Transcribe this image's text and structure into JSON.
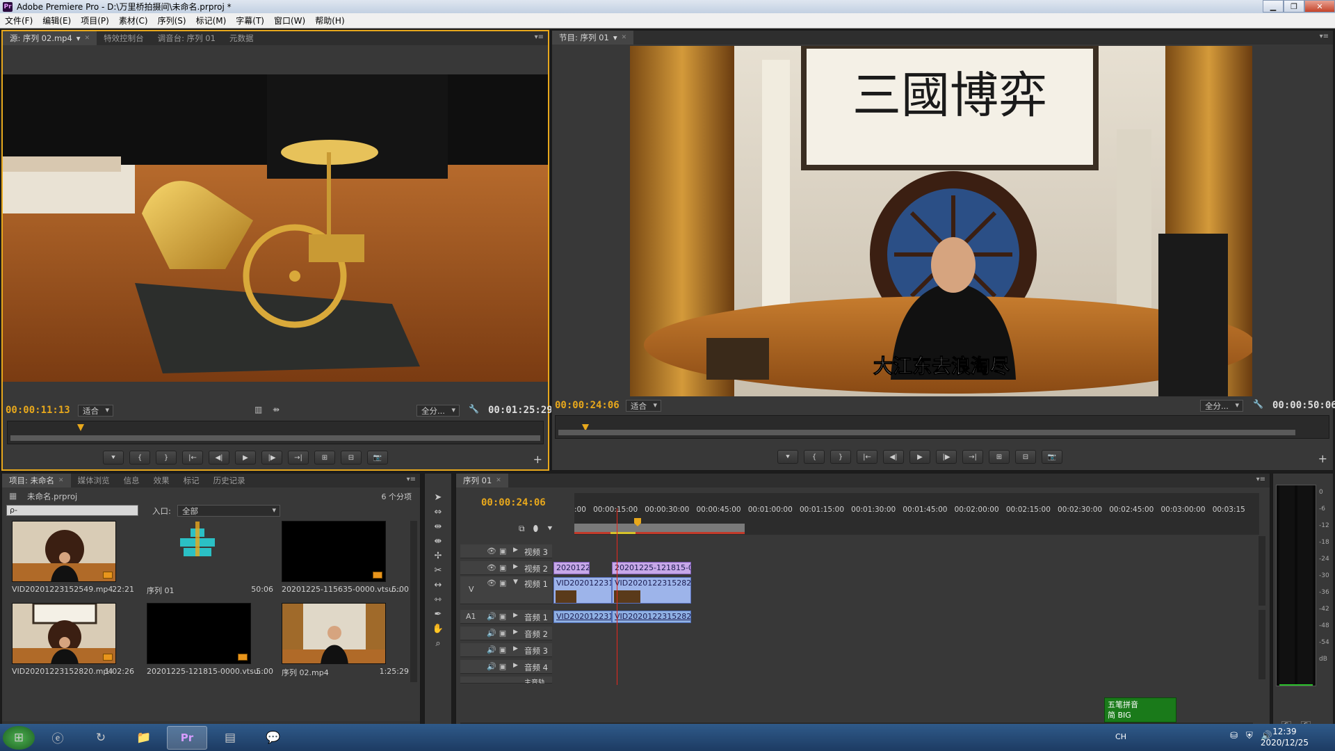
{
  "window": {
    "title": "Adobe Premiere Pro - D:\\万里桥拍摄间\\未命名.prproj *",
    "app_icon": "Pr"
  },
  "menu": [
    "文件(F)",
    "编辑(E)",
    "项目(P)",
    "素材(C)",
    "序列(S)",
    "标记(M)",
    "字幕(T)",
    "窗口(W)",
    "帮助(H)"
  ],
  "source": {
    "tabs": [
      "源: 序列 02.mp4",
      "特效控制台",
      "调音台: 序列 01",
      "元数据"
    ],
    "timecode": "00:00:11:13",
    "fit": "适合",
    "quality": "全分...",
    "duration": "00:01:25:29"
  },
  "program": {
    "tab": "节目: 序列 01",
    "subtitle": "大江东去浪淘尽",
    "calligraphy": "三國博弈",
    "timecode": "00:00:24:06",
    "fit": "适合",
    "quality": "全分...",
    "duration": "00:00:50:06"
  },
  "project": {
    "tabs": [
      "项目: 未命名",
      "媒体浏览",
      "信息",
      "效果",
      "标记",
      "历史记录"
    ],
    "file": "未命名.prproj",
    "count": "6 个分项",
    "search_placeholder": "ρ-",
    "in_label": "入口:",
    "in_value": "全部",
    "items": [
      {
        "name": "VID20201223152549.mp4",
        "dur": "22:21"
      },
      {
        "name": "序列 01",
        "dur": "50:06"
      },
      {
        "name": "20201225-115635-0000.vtsu...",
        "dur": "5:00"
      },
      {
        "name": "VID20201223152820.mp4",
        "dur": "1:02:26"
      },
      {
        "name": "20201225-121815-0000.vtsu...",
        "dur": "5:00"
      },
      {
        "name": "序列 02.mp4",
        "dur": "1:25:29"
      }
    ]
  },
  "timeline": {
    "tab": "序列 01",
    "timecode": "00:00:24:06",
    "ticks": [
      ":00",
      "00:00:15:00",
      "00:00:30:00",
      "00:00:45:00",
      "00:01:00:00",
      "00:01:15:00",
      "00:01:30:00",
      "00:01:45:00",
      "00:02:00:00",
      "00:02:15:00",
      "00:02:30:00",
      "00:02:45:00",
      "00:03:00:00",
      "00:03:15"
    ],
    "video_tracks": [
      "视频 3",
      "视频 2",
      "视频 1"
    ],
    "audio_tracks": [
      "音频 1",
      "音频 2",
      "音频 3",
      "音频 4"
    ],
    "master": "主音轨",
    "v_label": "V",
    "a_label": "A1",
    "clips": {
      "v2a": "20201225",
      "v2b": "20201225-121815-0000.vtsu",
      "v1a": "VID20201223152549",
      "v1b": "VID20201223152820.mp4",
      "a1a": "VID20201223152549",
      "a1b": "VID20201223152820.mp4"
    }
  },
  "meter": {
    "labels": [
      "0",
      "-6",
      "-12",
      "-18",
      "-24",
      "-30",
      "-36",
      "-42",
      "-48",
      "-54",
      "dB"
    ],
    "solo": "S"
  },
  "ime": {
    "name": "五笔拼音",
    "mode": "简 BIG"
  },
  "taskbar": {
    "lang": "CH",
    "time": "12:39",
    "date": "2020/12/25"
  }
}
